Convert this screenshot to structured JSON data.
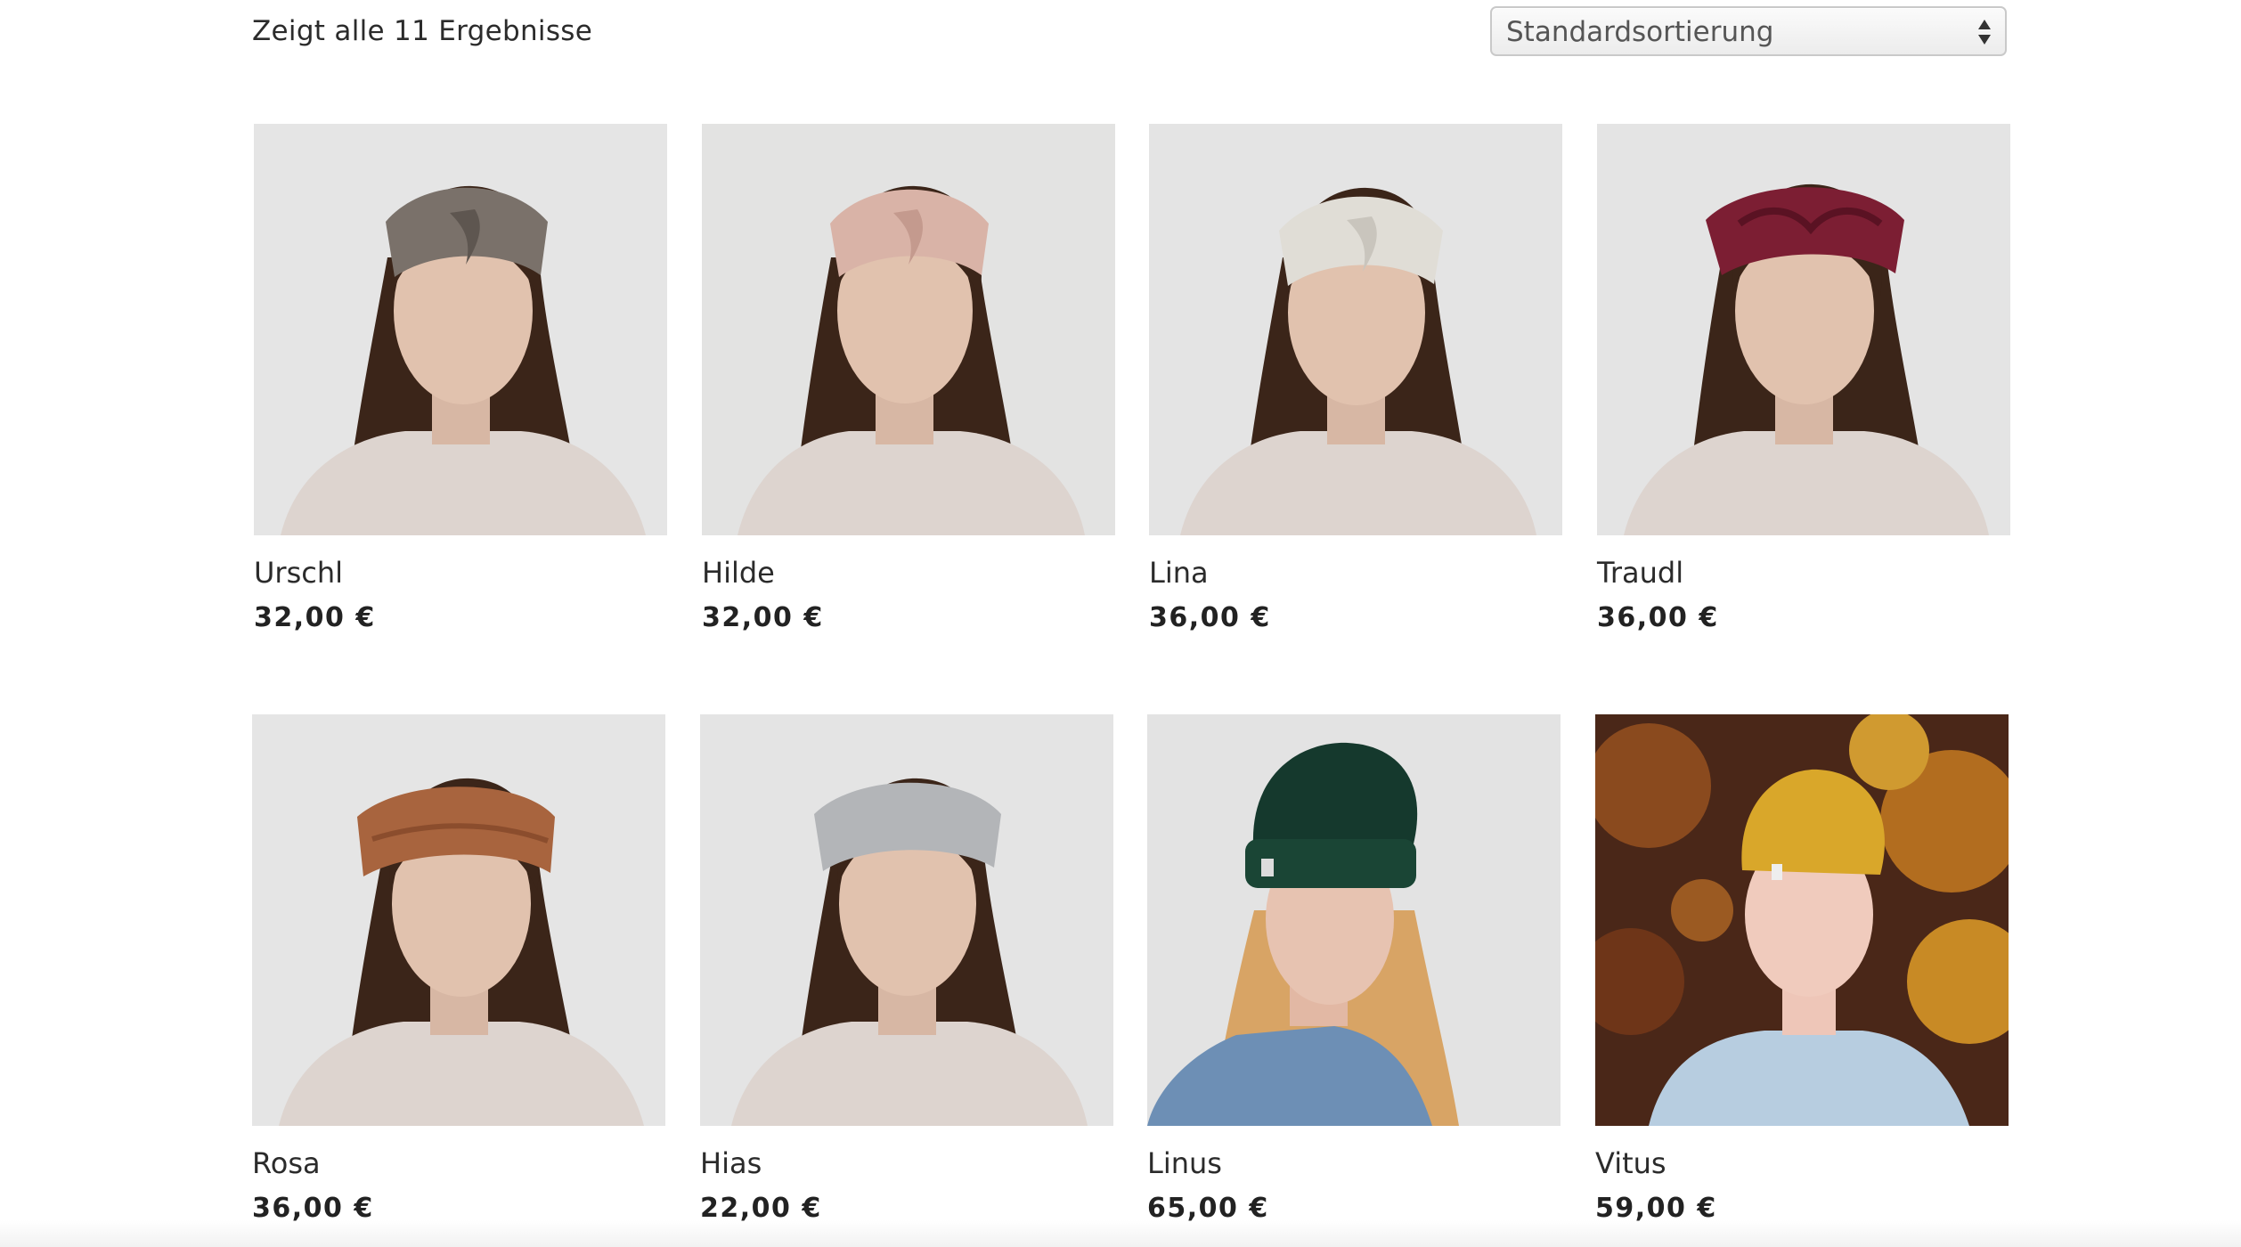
{
  "shop": {
    "result_count": "Zeigt alle 11 Ergebnisse",
    "sort": {
      "selected": "Standardsortierung",
      "icon": "sort-arrows-icon"
    }
  },
  "products": [
    {
      "name": "Urschl",
      "price": "32,00 €",
      "image": "woman-brown-knit-twist-headband",
      "band_color": "#7a716a"
    },
    {
      "name": "Hilde",
      "price": "32,00 €",
      "image": "woman-pink-knit-twist-headband",
      "band_color": "#d9b3a7"
    },
    {
      "name": "Lina",
      "price": "36,00 €",
      "image": "woman-cream-knit-twist-headband",
      "band_color": "#e0ddd6"
    },
    {
      "name": "Traudl",
      "price": "36,00 €",
      "image": "woman-burgundy-braided-headband",
      "band_color": "#7c1e33"
    },
    {
      "name": "Rosa",
      "price": "36,00 €",
      "image": "woman-rust-cable-headband",
      "band_color": "#a8643e"
    },
    {
      "name": "Hias",
      "price": "22,00 €",
      "image": "woman-grey-knit-headband",
      "band_color": "#b3b5b8"
    },
    {
      "name": "Linus",
      "price": "65,00 €",
      "image": "woman-dark-green-beanie",
      "band_color": "#15392d"
    },
    {
      "name": "Vitus",
      "price": "59,00 €",
      "image": "woman-yellow-beanie-autumn",
      "band_color": "#d9a72a"
    }
  ],
  "colors": {
    "text": "#2b2b2b",
    "price": "#222222",
    "photo_background": "#e4e4e4",
    "sweater": "#ddd3cd",
    "hair_dark": "#3a2519"
  }
}
